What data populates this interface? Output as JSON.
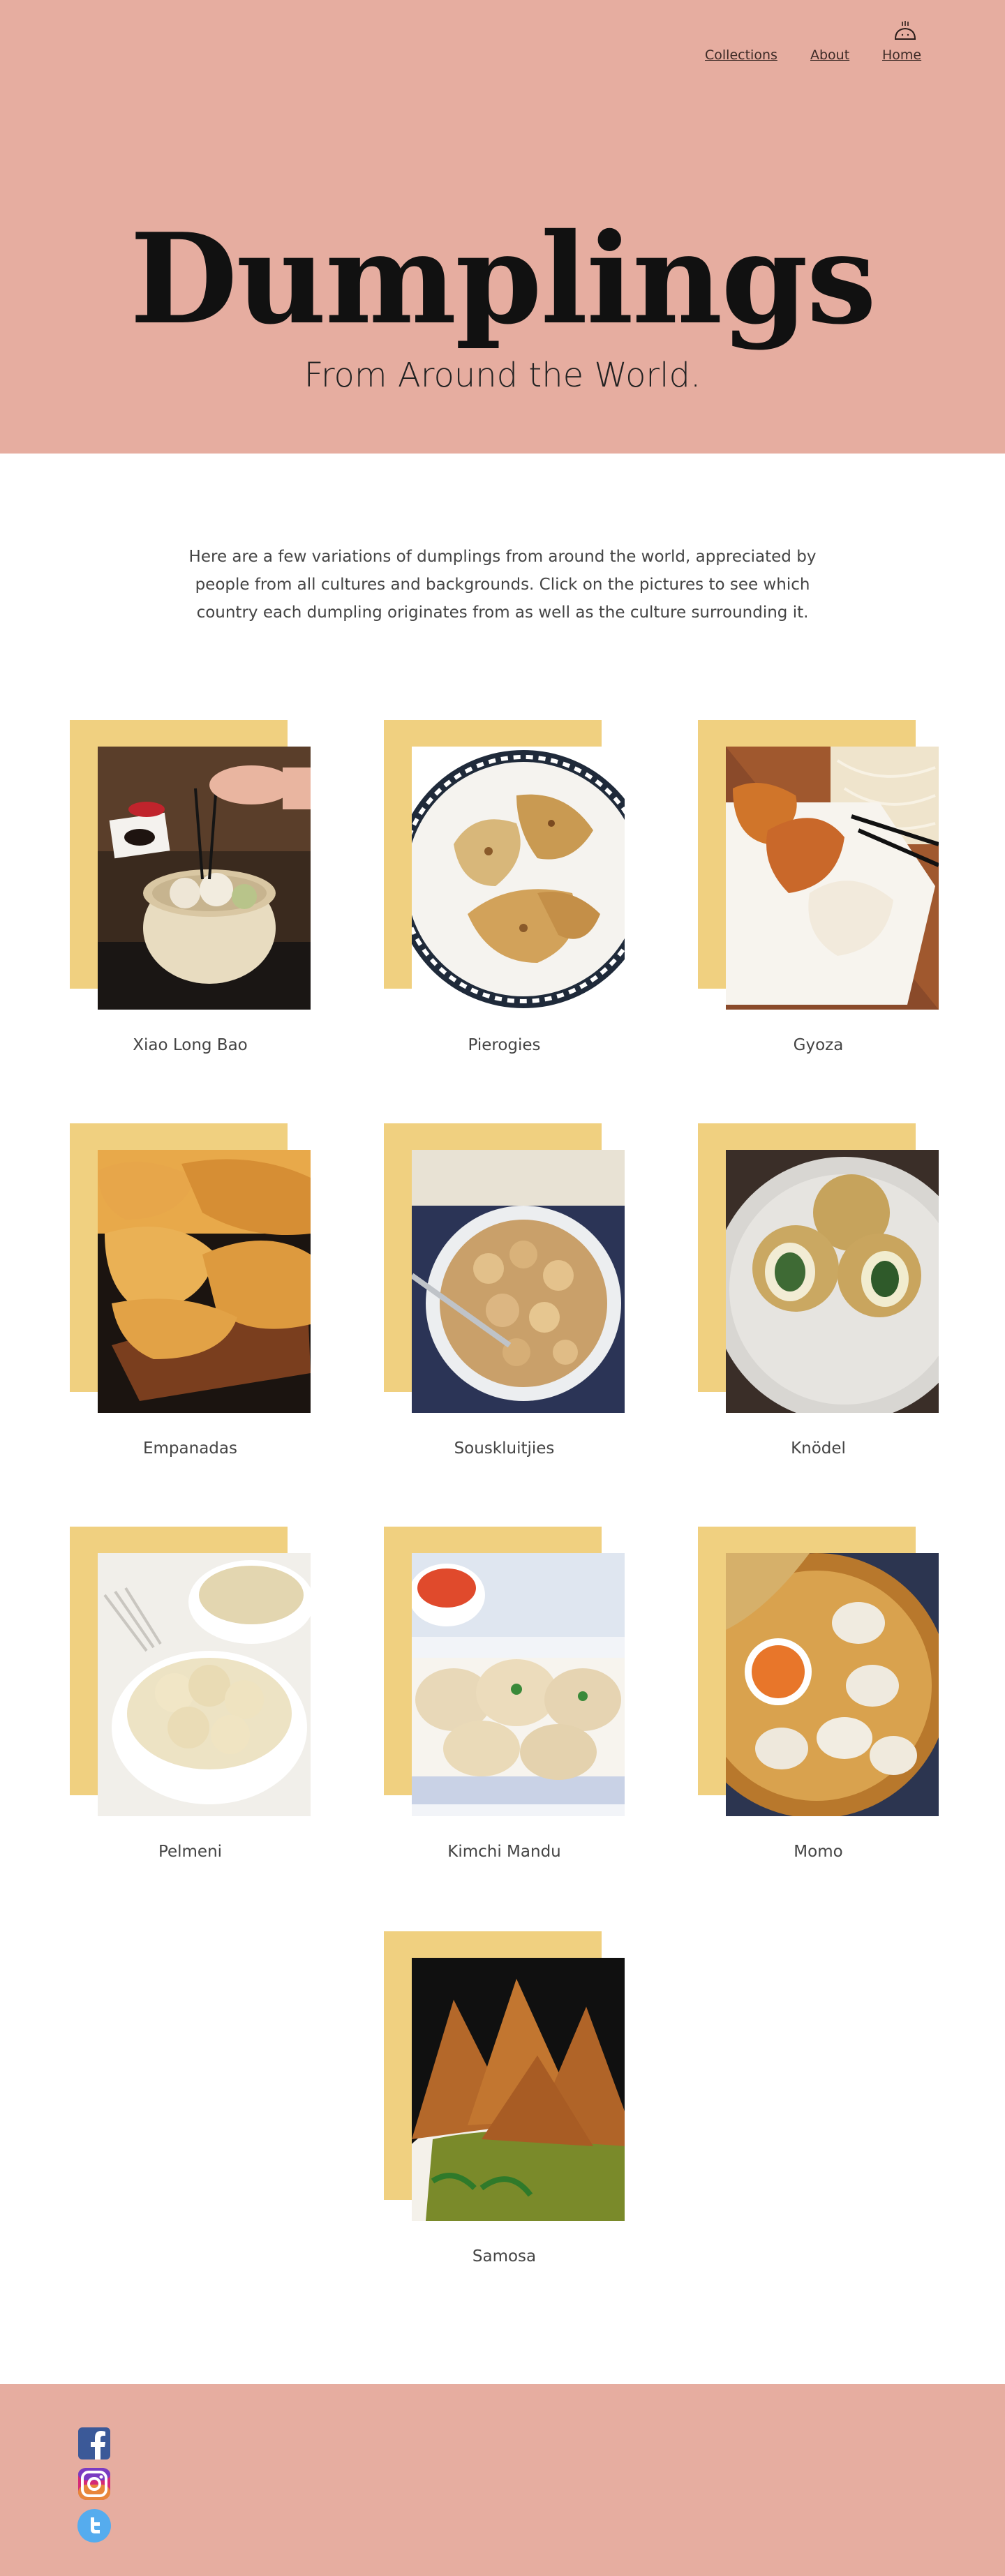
{
  "nav": {
    "logo_icon": "dumpling-logo-icon",
    "links": [
      {
        "label": "Collections"
      },
      {
        "label": "About"
      },
      {
        "label": "Home"
      }
    ]
  },
  "hero": {
    "title": "Dumplings",
    "subtitle": "From Around the World."
  },
  "intro": {
    "text": "Here are a few variations of dumplings from around the world, appreciated by people from all cultures and backgrounds. Click on the pictures to see which country each dumpling originates from as well as the culture surrounding it."
  },
  "dumplings": [
    {
      "name": "Xiao Long Bao"
    },
    {
      "name": "Pierogies"
    },
    {
      "name": "Gyoza"
    },
    {
      "name": "Empanadas"
    },
    {
      "name": "Souskluitjies"
    },
    {
      "name": "Knödel"
    },
    {
      "name": "Pelmeni"
    },
    {
      "name": "Kimchi Mandu"
    },
    {
      "name": "Momo"
    },
    {
      "name": "Samosa"
    }
  ],
  "footer": {
    "social": [
      {
        "icon": "facebook-icon"
      },
      {
        "icon": "instagram-icon"
      },
      {
        "icon": "twitter-icon"
      }
    ]
  },
  "colors": {
    "hero_bg": "#e6ada0",
    "accent_backing": "#f0d080",
    "footer_bg": "#e6ada0"
  }
}
